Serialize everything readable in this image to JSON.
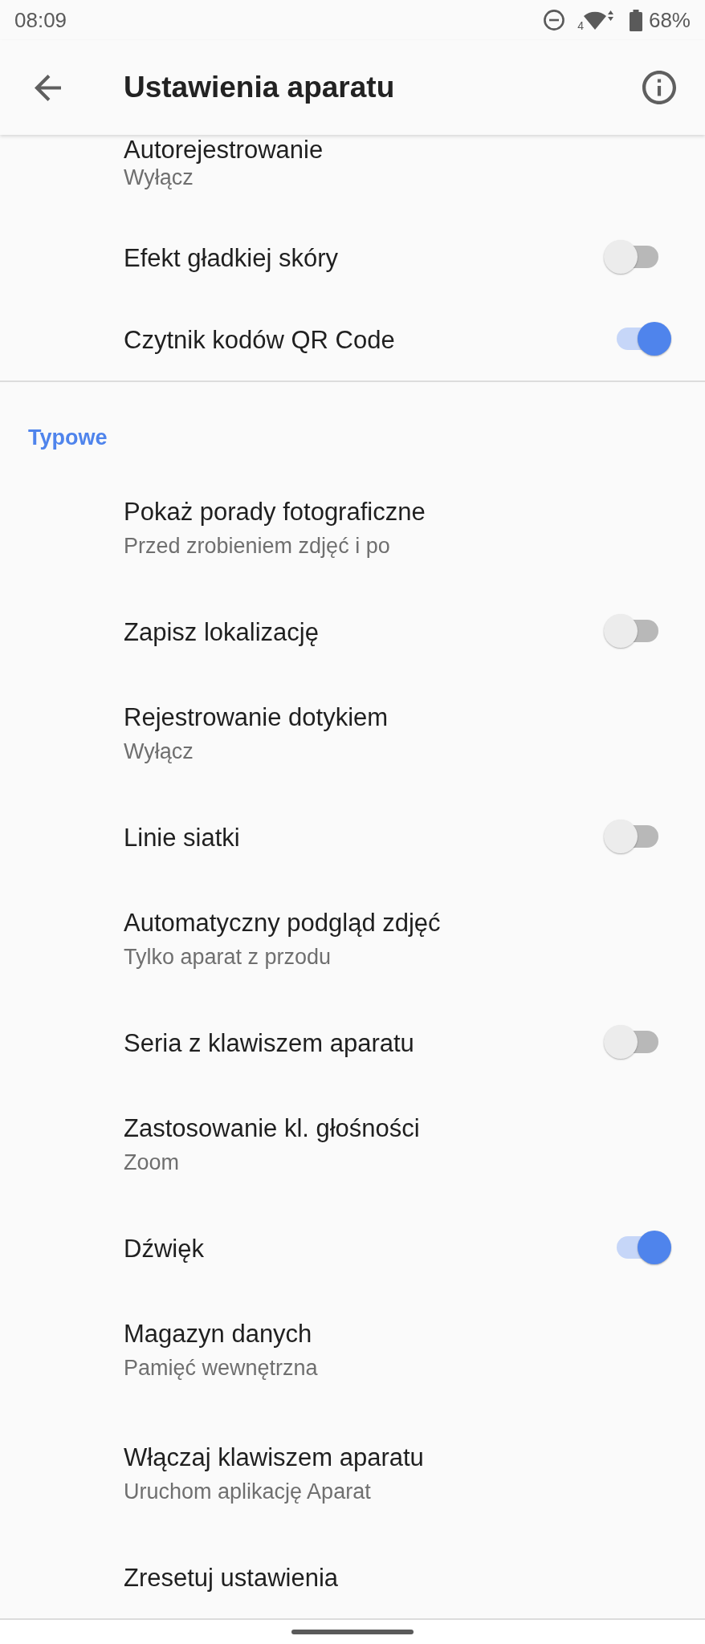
{
  "status_bar": {
    "time": "08:09",
    "network_type": "4",
    "battery": "68%"
  },
  "app_bar": {
    "title": "Ustawienia aparatu"
  },
  "sections": [
    {
      "items": [
        {
          "kind": "text",
          "title": "Autorejestrowanie",
          "subtitle": "Wyłącz"
        },
        {
          "kind": "switch",
          "title": "Efekt gładkiej skóry",
          "on": false
        },
        {
          "kind": "switch",
          "title": "Czytnik kodów QR Code",
          "on": true
        }
      ]
    },
    {
      "header": "Typowe",
      "items": [
        {
          "kind": "text",
          "title": "Pokaż porady fotograficzne",
          "subtitle": "Przed zrobieniem zdjęć i po"
        },
        {
          "kind": "switch",
          "title": "Zapisz lokalizację",
          "on": false
        },
        {
          "kind": "text",
          "title": "Rejestrowanie dotykiem",
          "subtitle": "Wyłącz"
        },
        {
          "kind": "switch",
          "title": "Linie siatki",
          "on": false
        },
        {
          "kind": "text",
          "title": "Automatyczny podgląd zdjęć",
          "subtitle": "Tylko aparat z przodu"
        },
        {
          "kind": "switch",
          "title": "Seria z klawiszem aparatu",
          "on": false
        },
        {
          "kind": "text",
          "title": "Zastosowanie kl. głośności",
          "subtitle": "Zoom"
        },
        {
          "kind": "switch",
          "title": "Dźwięk",
          "on": true
        },
        {
          "kind": "text",
          "title": "Magazyn danych",
          "subtitle": "Pamięć wewnętrzna"
        },
        {
          "kind": "text",
          "title": "Włączaj klawiszem aparatu",
          "subtitle": "Uruchom aplikację Aparat"
        },
        {
          "kind": "text",
          "title": "Zresetuj ustawienia"
        }
      ]
    }
  ]
}
